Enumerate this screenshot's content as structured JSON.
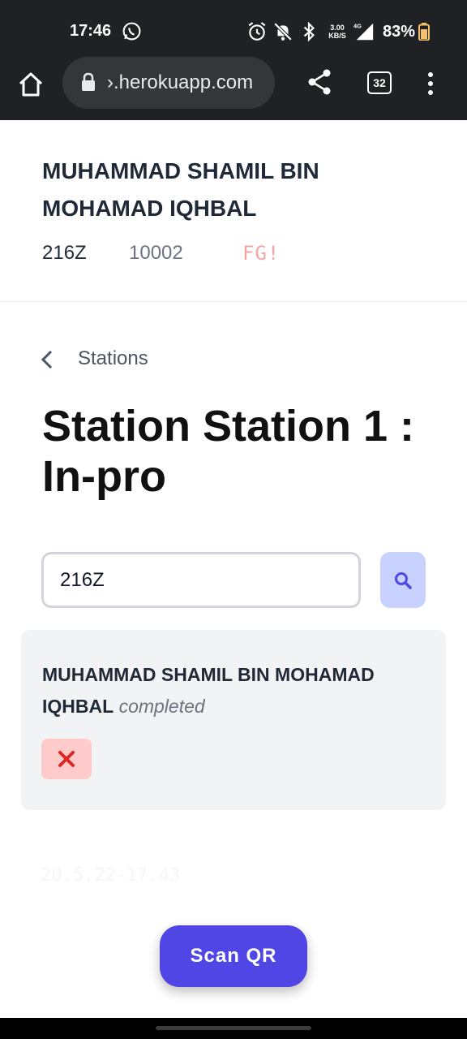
{
  "status_bar": {
    "time": "17:46",
    "network_speed_value": "3.00",
    "network_speed_unit": "KB/S",
    "network_type": "4G",
    "battery": "83%",
    "icons": [
      "whatsapp-icon",
      "alarm-icon",
      "mute-icon",
      "bluetooth-icon",
      "signal-icon",
      "battery-icon"
    ]
  },
  "browser": {
    "url": "›.herokuapp.com",
    "tab_count": "32",
    "icons": [
      "home-icon",
      "lock-icon",
      "share-icon",
      "tabs-icon",
      "menu-icon"
    ]
  },
  "student": {
    "name": "MUHAMMAD SHAMIL BIN MOHAMAD IQHBAL",
    "code": "216Z",
    "id": "10002",
    "flag": "FG!"
  },
  "breadcrumb": {
    "back_label": "Stations"
  },
  "page": {
    "title": "Station Station 1 : In-pro"
  },
  "search": {
    "value": "216Z"
  },
  "result": {
    "name": "MUHAMMAD SHAMIL BIN MOHAMAD IQHBAL",
    "status": "completed"
  },
  "footer": {
    "timestamp": "20.5.22-17.43",
    "scan_button_label": "Scan QR"
  },
  "colors": {
    "accent": "#4f46e5",
    "search_button_bg": "#c7d2fe",
    "remove_button_bg": "#fecaca",
    "remove_icon": "#dc2626",
    "flag_text": "#f3a5a5"
  }
}
